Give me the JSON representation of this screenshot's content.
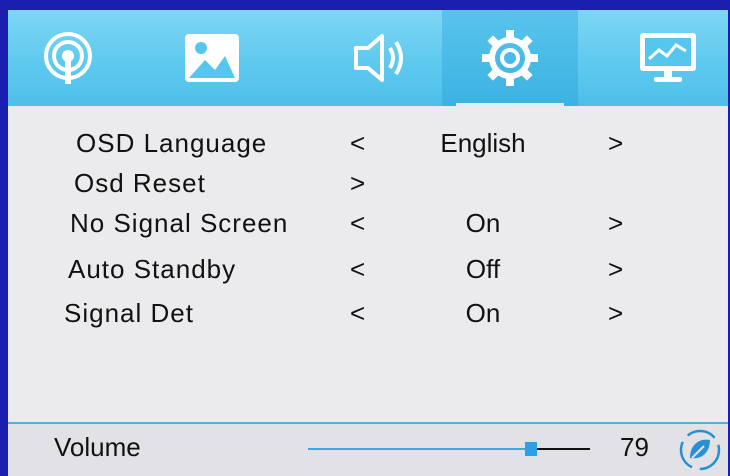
{
  "tabs": [
    {
      "icon": "signal-icon",
      "active": false
    },
    {
      "icon": "picture-icon",
      "active": false
    },
    {
      "icon": "speaker-icon",
      "active": false
    },
    {
      "icon": "gear-icon",
      "active": true
    },
    {
      "icon": "monitor-icon",
      "active": false
    }
  ],
  "menu": {
    "items": [
      {
        "label": "OSD Language",
        "left_arrow": "<",
        "value": "English",
        "right_arrow": ">"
      },
      {
        "label": "Osd Reset",
        "left_arrow": ">",
        "value": "",
        "right_arrow": ""
      },
      {
        "label": "No Signal Screen",
        "left_arrow": "<",
        "value": "On",
        "right_arrow": ">"
      },
      {
        "label": "Auto Standby",
        "left_arrow": "<",
        "value": "Off",
        "right_arrow": ">"
      },
      {
        "label": "Signal Det",
        "left_arrow": "<",
        "value": "On",
        "right_arrow": ">"
      }
    ]
  },
  "volume": {
    "label": "Volume",
    "value": "79",
    "level": 0.79
  },
  "colors": {
    "accent": "#39a9e0",
    "tab_bar": "#5cc8ee",
    "background": "#ebebed"
  }
}
